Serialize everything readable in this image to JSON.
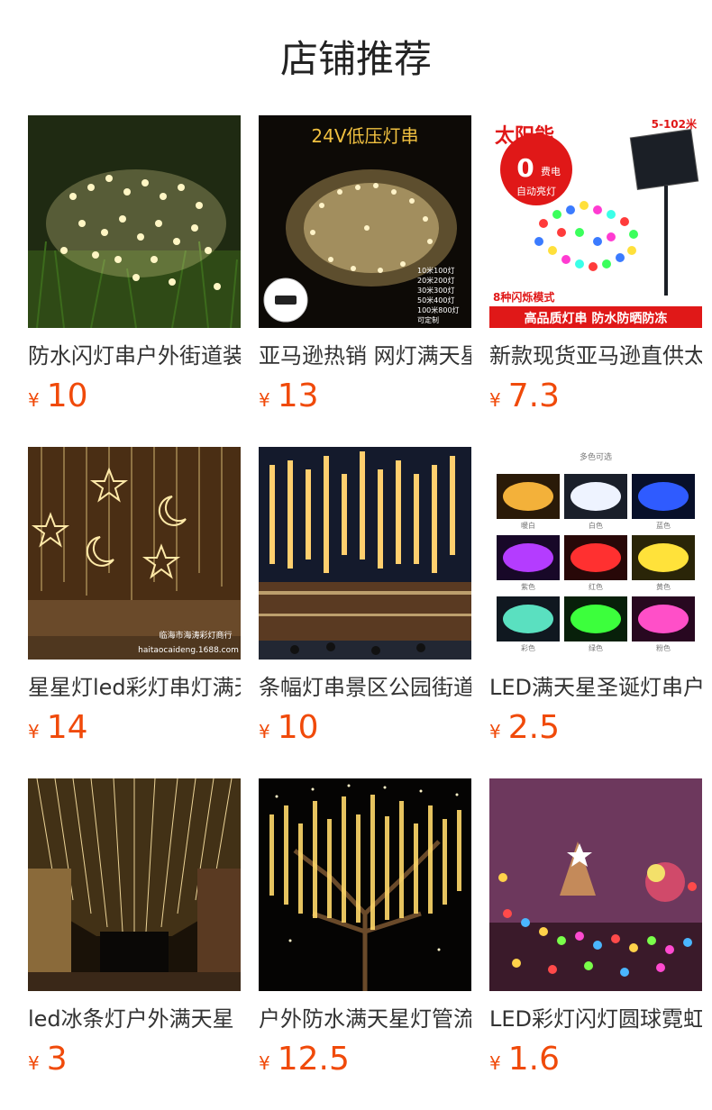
{
  "header": {
    "title": "店铺推荐"
  },
  "colors": {
    "price": "#f04a0a",
    "text": "#333333"
  },
  "products": [
    {
      "name": "防水闪灯串户外街道装饰",
      "currency": "¥",
      "price": "10",
      "image": "warm-string-lights-on-grass"
    },
    {
      "name": "亚马逊热销 网灯满天星",
      "currency": "¥",
      "price": "13",
      "image": "24v-low-voltage-light-string",
      "image_text": {
        "banner": "24V低压灯串",
        "specs": [
          "10米100灯",
          "20米200灯",
          "30米300灯",
          "50米400灯",
          "100米800灯",
          "可定制"
        ]
      }
    },
    {
      "name": "新款现货亚马逊直供太阳能",
      "currency": "¥",
      "price": "7.3",
      "image": "solar-colorful-string-lights",
      "image_text": {
        "brand": "太阳能",
        "badge_big": "0",
        "badge_small": "费电",
        "badge_line": "自动亮灯",
        "length": "5-102米",
        "modes": "8种闪烁模式",
        "footer": "高品质灯串  防水防晒防冻"
      }
    },
    {
      "name": "星星灯led彩灯串灯满天星",
      "currency": "¥",
      "price": "14",
      "image": "star-moon-curtain-lights",
      "image_text": {
        "watermark1": "临海市海涛彩灯商行",
        "watermark2": "haitaocaideng.1688.com"
      }
    },
    {
      "name": "条幅灯串景区公园街道",
      "currency": "¥",
      "price": "10",
      "image": "street-banner-lights-at-night"
    },
    {
      "name": "LED满天星圣诞灯串户外",
      "currency": "¥",
      "price": "2.5",
      "image": "color-options-grid",
      "image_text": {
        "header": "多色可选",
        "colors": [
          "暖白",
          "白色",
          "蓝色",
          "紫色",
          "红色",
          "黄色",
          "彩色",
          "绿色",
          "粉色"
        ]
      }
    },
    {
      "name": "led冰条灯户外满天星",
      "currency": "¥",
      "price": "3",
      "image": "icicle-lights-street-canopy"
    },
    {
      "name": "户外防水满天星灯管流星",
      "currency": "¥",
      "price": "12.5",
      "image": "meteor-tube-lights-on-tree"
    },
    {
      "name": "LED彩灯闪灯圆球霓虹",
      "currency": "¥",
      "price": "1.6",
      "image": "colorful-star-lights-room"
    }
  ]
}
